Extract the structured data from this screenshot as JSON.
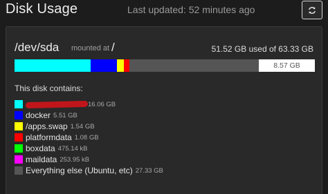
{
  "header": {
    "title": "Disk Usage",
    "last_updated": "Last updated: 52 minutes ago",
    "refresh_icon": "refresh-icon"
  },
  "disk": {
    "device": "/dev/sda",
    "mounted_text": "mounted at",
    "mount_point": "/",
    "usage_summary": "51.52 GB used of 63.33 GB",
    "used_gb": 51.52,
    "total_gb": 63.33,
    "free_label": "8.57 GB"
  },
  "contains_label": "This disk contains:",
  "items": [
    {
      "name": "",
      "size": "16.06 GB",
      "color": "#00ffff",
      "gb": 16.06,
      "redacted": true
    },
    {
      "name": "docker",
      "size": "5.51 GB",
      "color": "#0000ff",
      "gb": 5.51
    },
    {
      "name": "/apps.swap",
      "size": "1.54 GB",
      "color": "#ffff00",
      "gb": 1.54
    },
    {
      "name": "platformdata",
      "size": "1.08 GB",
      "color": "#ff0000",
      "gb": 1.08
    },
    {
      "name": "boxdata",
      "size": "475.14 kB",
      "color": "#00ff00",
      "gb": 0.0005
    },
    {
      "name": "maildata",
      "size": "253.95 kB",
      "color": "#ff00ff",
      "gb": 0.0003
    },
    {
      "name": "Everything else (Ubuntu, etc)",
      "size": "27.33 GB",
      "color": "#555555",
      "gb": 27.33
    }
  ],
  "free_color": "#ffffff"
}
